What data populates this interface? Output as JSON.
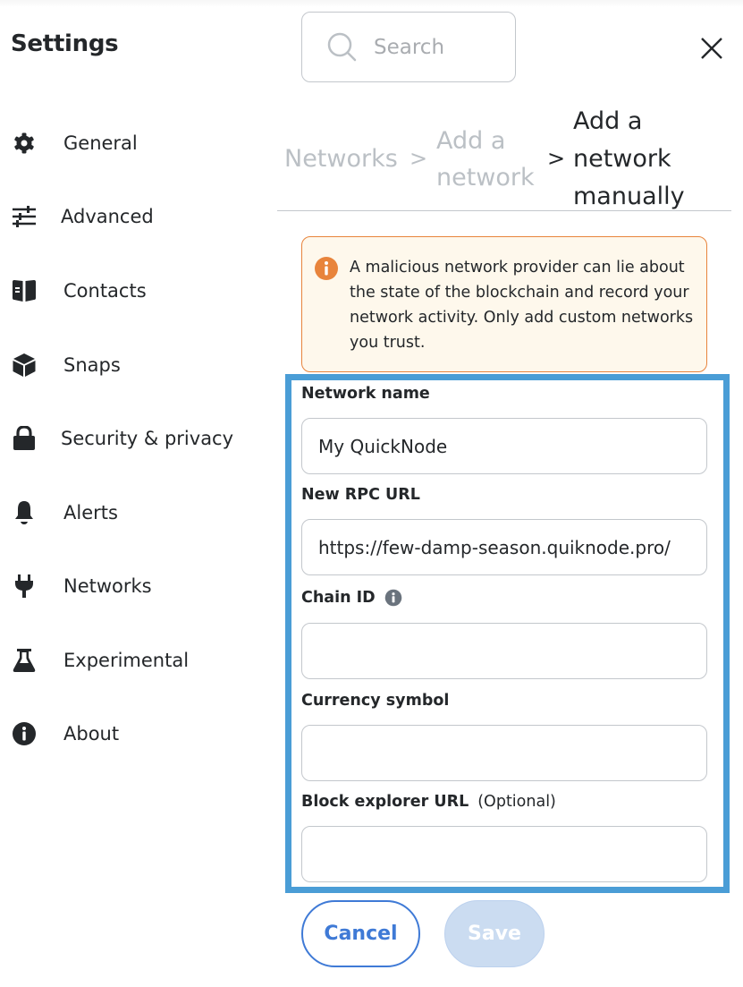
{
  "header": {
    "title": "Settings",
    "search_placeholder": "Search",
    "close_icon": "close-icon"
  },
  "sidebar": {
    "items": [
      {
        "label": "General",
        "icon": "gear-icon"
      },
      {
        "label": "Advanced",
        "icon": "sliders-icon"
      },
      {
        "label": "Contacts",
        "icon": "book-icon"
      },
      {
        "label": "Snaps",
        "icon": "cube-icon"
      },
      {
        "label": "Security & privacy",
        "icon": "lock-icon"
      },
      {
        "label": "Alerts",
        "icon": "bell-icon"
      },
      {
        "label": "Networks",
        "icon": "plug-icon"
      },
      {
        "label": "Experimental",
        "icon": "flask-icon"
      },
      {
        "label": "About",
        "icon": "info-icon"
      }
    ]
  },
  "breadcrumb": {
    "items": [
      "Networks",
      "Add a network",
      "Add a network manually"
    ],
    "lines": {
      "networks": "Networks",
      "add_network_1": "Add a",
      "add_network_2": "network",
      "manual_1": "Add a",
      "manual_2": "network",
      "manual_3": "manually"
    },
    "separator": ">"
  },
  "warning": {
    "icon": "info-icon",
    "text": "A malicious network provider can lie about the state of the blockchain and record your network activity. Only add custom networks you trust.",
    "color": "#e8843c"
  },
  "form": {
    "fields": [
      {
        "label": "Network name",
        "value": "My QuickNode",
        "optional": ""
      },
      {
        "label": "New RPC URL",
        "value": "https://few-damp-season.quiknode.pro/",
        "optional": ""
      },
      {
        "label": "Chain ID",
        "value": "",
        "optional": "",
        "info_icon": "info-icon"
      },
      {
        "label": "Currency symbol",
        "value": "",
        "optional": ""
      },
      {
        "label": "Block explorer URL",
        "value": "",
        "optional": "(Optional)"
      }
    ],
    "highlight_color": "#4a9dd6"
  },
  "actions": {
    "cancel_label": "Cancel",
    "save_label": "Save",
    "save_disabled": true,
    "accent": "#3f7ad6"
  }
}
